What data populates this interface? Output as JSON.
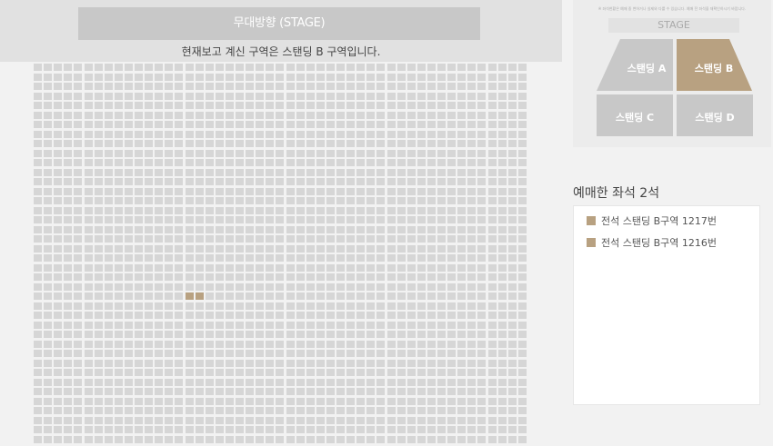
{
  "stage_banner": {
    "label": "무대방향 (STAGE)"
  },
  "section_notice": "현재보고 계신 구역은 스탠딩 B 구역입니다.",
  "seat_grid": {
    "rows": 40,
    "cols": 49,
    "seat_color": "#d6d6d6",
    "booked_color": "#b8a181",
    "booked_seats": [
      {
        "row": 24,
        "col": 15
      },
      {
        "row": 24,
        "col": 16
      }
    ]
  },
  "mini_map": {
    "notice": "※ 좌석현황은 예매 중 변하거나 실제와 다를 수 있습니다. 예매 전 좌석을 재확인하시기 바랍니다.",
    "stage_label": "STAGE",
    "zones": [
      {
        "id": "A",
        "label": "스탠딩 A",
        "selected": false
      },
      {
        "id": "B",
        "label": "스탠딩 B",
        "selected": true
      },
      {
        "id": "C",
        "label": "스탠딩 C",
        "selected": false
      },
      {
        "id": "D",
        "label": "스탠딩 D",
        "selected": false
      }
    ],
    "zone_color": "#c8c8c8",
    "selected_color": "#b8a181"
  },
  "booked_panel": {
    "title": "예매한 좌석 2석",
    "items": [
      {
        "label": "전석 스탠딩 B구역 1217번"
      },
      {
        "label": "전석 스탠딩 B구역 1216번"
      }
    ]
  }
}
